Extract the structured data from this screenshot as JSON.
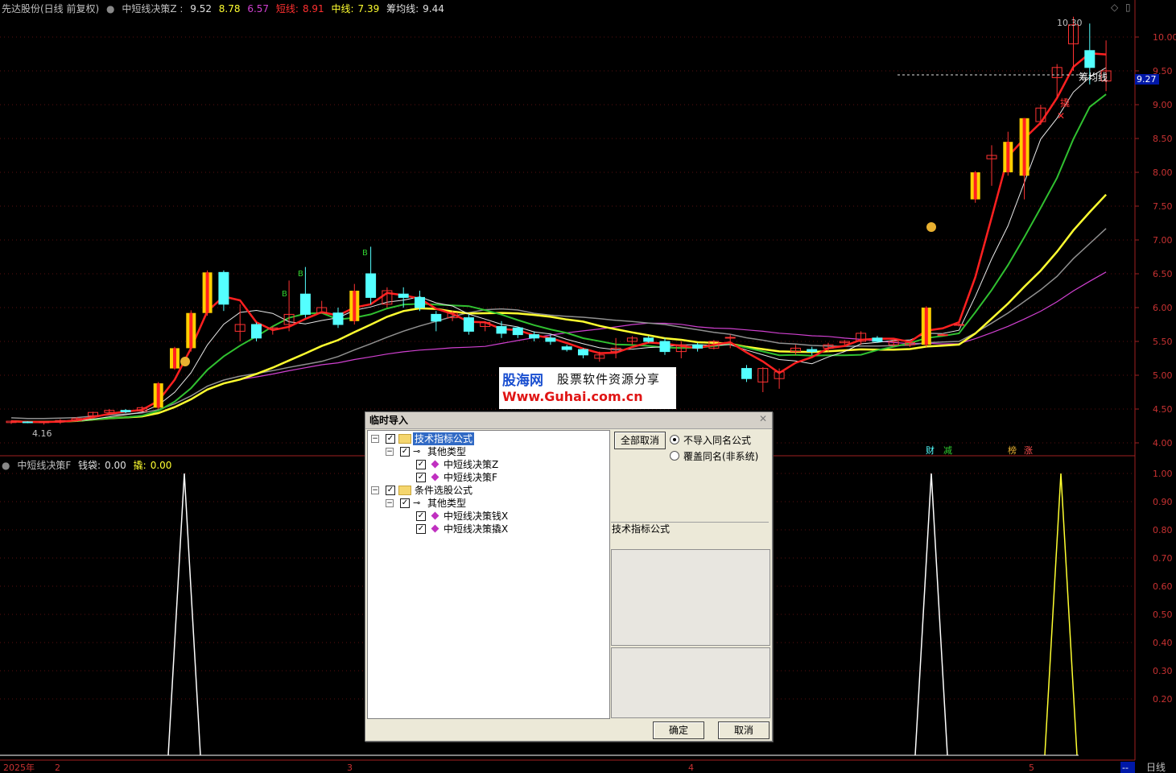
{
  "header": {
    "stock_name": "先达股份(日线 前复权)",
    "indicator_name": "中短线决策Z :",
    "v1": "9.52",
    "v2": "8.78",
    "v3": "6.57",
    "short_label": "短线:",
    "short_value": "8.91",
    "mid_label": "中线:",
    "mid_value": "7.39",
    "chip_label": "筹均线:",
    "chip_value": "9.44"
  },
  "sub_header": {
    "indicator_name": "中短线决策F",
    "money_label": "钱袋:",
    "money_value": "0.00",
    "pry_label": "撬:",
    "pry_value": "0.00"
  },
  "price_axis": [
    "10.00",
    "9.50",
    "9.00",
    "8.50",
    "8.00",
    "7.50",
    "7.00",
    "6.50",
    "6.00",
    "5.50",
    "5.00",
    "4.50",
    "4.00"
  ],
  "price_tag": "9.27",
  "sub_axis": [
    "1.00",
    "0.90",
    "0.80",
    "0.70",
    "0.60",
    "0.50",
    "0.40",
    "0.30",
    "0.20"
  ],
  "time_axis": {
    "year": "2025年",
    "m2": "2",
    "m3": "3",
    "m4": "4",
    "m5": "5",
    "period": "日线",
    "dash": "--"
  },
  "annotations": {
    "high": "10.30",
    "low": "4.16",
    "chip_line": "筹均线",
    "pry": "撬",
    "buy": "B",
    "sig_cai": "财",
    "sig_jian": "减",
    "sig_bang": "榜",
    "sig_zhang": "涨"
  },
  "colors": {
    "up": "#ff3232",
    "down": "#54ffff",
    "short": "#ff2020",
    "mid": "#ffff30",
    "ma_white": "#e8e8e8",
    "ma_magenta": "#d040d0",
    "ma_gray": "#909090",
    "ribbon": "#30c030"
  },
  "watermark": {
    "logo": "股海网",
    "slogan": "股票软件资源分享",
    "url": "Www.Guhai.com.cn"
  },
  "dialog": {
    "title": "临时导入",
    "tree": {
      "group1": "技术指标公式",
      "group1_sub": "其他类型",
      "item1": "中短线决策Z",
      "item2": "中短线决策F",
      "group2": "条件选股公式",
      "group2_sub": "其他类型",
      "item3": "中短线决策钱X",
      "item4": "中短线决策撬X"
    },
    "cancel_all": "全部取消",
    "radio1": "不导入同名公式",
    "radio2": "覆盖同名(非系统)",
    "info_label": "技术指标公式",
    "ok": "确定",
    "cancel": "取消"
  },
  "chart_data": {
    "type": "candlestick",
    "candles": [
      [
        4.3,
        4.32,
        4.28,
        4.33
      ],
      [
        4.31,
        4.3,
        4.29,
        4.32
      ],
      [
        4.3,
        4.31,
        4.27,
        4.32
      ],
      [
        4.31,
        4.33,
        4.28,
        4.35
      ],
      [
        4.33,
        4.36,
        4.31,
        4.38
      ],
      [
        4.4,
        4.45,
        4.38,
        4.46
      ],
      [
        4.45,
        4.48,
        4.43,
        4.5
      ],
      [
        4.48,
        4.46,
        4.44,
        4.5
      ],
      [
        4.47,
        4.52,
        4.46,
        4.54
      ],
      [
        4.52,
        4.88,
        4.5,
        4.9
      ],
      [
        5.1,
        5.4,
        5.08,
        5.42
      ],
      [
        5.4,
        5.92,
        5.35,
        5.96
      ],
      [
        5.92,
        6.52,
        5.88,
        6.55
      ],
      [
        6.52,
        6.05,
        5.95,
        6.55
      ],
      [
        5.65,
        5.75,
        5.5,
        6.05
      ],
      [
        5.75,
        5.55,
        5.5,
        5.78
      ],
      [
        5.68,
        5.7,
        5.6,
        5.72
      ],
      [
        5.75,
        5.9,
        5.65,
        6.4
      ],
      [
        6.2,
        5.9,
        5.85,
        6.6
      ],
      [
        5.92,
        6.0,
        5.95,
        6.1
      ],
      [
        5.92,
        5.75,
        5.7,
        6.0
      ],
      [
        5.8,
        6.25,
        5.75,
        6.35
      ],
      [
        6.5,
        6.15,
        6.05,
        6.9
      ],
      [
        6.05,
        6.25,
        6.0,
        6.3
      ],
      [
        6.2,
        6.15,
        6.0,
        6.3
      ],
      [
        6.15,
        6.0,
        5.95,
        6.25
      ],
      [
        5.9,
        5.8,
        5.65,
        5.95
      ],
      [
        5.85,
        5.92,
        5.8,
        5.95
      ],
      [
        5.85,
        5.65,
        5.6,
        5.9
      ],
      [
        5.72,
        5.78,
        5.65,
        5.8
      ],
      [
        5.72,
        5.62,
        5.55,
        5.8
      ],
      [
        5.7,
        5.6,
        5.55,
        5.72
      ],
      [
        5.6,
        5.55,
        5.5,
        5.65
      ],
      [
        5.55,
        5.5,
        5.45,
        5.6
      ],
      [
        5.42,
        5.38,
        5.35,
        5.45
      ],
      [
        5.38,
        5.3,
        5.25,
        5.4
      ],
      [
        5.25,
        5.3,
        5.2,
        5.35
      ],
      [
        5.35,
        5.4,
        5.25,
        5.55
      ],
      [
        5.5,
        5.55,
        5.45,
        5.58
      ],
      [
        5.55,
        5.5,
        5.48,
        5.58
      ],
      [
        5.5,
        5.35,
        5.3,
        5.55
      ],
      [
        5.35,
        5.45,
        5.25,
        5.5
      ],
      [
        5.45,
        5.4,
        5.35,
        5.48
      ],
      [
        5.4,
        5.5,
        5.38,
        5.52
      ],
      [
        5.55,
        5.56,
        5.4,
        5.6
      ],
      [
        5.1,
        4.95,
        4.9,
        5.15
      ],
      [
        4.9,
        5.1,
        4.75,
        5.12
      ],
      [
        4.95,
        5.05,
        4.8,
        5.1
      ],
      [
        5.35,
        5.4,
        5.3,
        5.45
      ],
      [
        5.38,
        5.35,
        5.3,
        5.42
      ],
      [
        5.4,
        5.45,
        5.35,
        5.48
      ],
      [
        5.48,
        5.5,
        5.45,
        5.52
      ],
      [
        5.5,
        5.62,
        5.45,
        5.65
      ],
      [
        5.55,
        5.5,
        5.48,
        5.58
      ],
      [
        5.45,
        5.5,
        5.42,
        5.52
      ],
      [
        5.45,
        5.48,
        5.42,
        5.5
      ],
      [
        5.45,
        6.0,
        5.42,
        6.02
      ],
      [
        5.6,
        5.6,
        5.58,
        5.62
      ],
      [
        5.75,
        5.75,
        5.72,
        5.78
      ],
      [
        7.6,
        8.0,
        7.55,
        8.02
      ],
      [
        8.2,
        8.25,
        7.8,
        8.4
      ],
      [
        8.0,
        8.45,
        7.95,
        8.6
      ],
      [
        7.95,
        8.8,
        7.6,
        8.8
      ],
      [
        8.75,
        8.95,
        8.7,
        9.0
      ],
      [
        9.4,
        9.55,
        9.1,
        9.6
      ],
      [
        9.9,
        10.18,
        9.5,
        10.3
      ],
      [
        9.8,
        9.55,
        9.3,
        10.2
      ],
      [
        9.35,
        9.5,
        9.2,
        9.95
      ]
    ],
    "short_line": [
      4.8,
      4.6,
      4.42,
      4.35,
      4.33,
      4.35,
      4.38,
      4.4,
      4.45,
      4.55,
      4.85,
      5.2,
      5.45,
      5.6,
      5.62,
      5.68,
      5.7,
      5.73,
      5.8,
      5.9,
      6.0,
      6.05,
      6.1
    ],
    "mid_line": [
      4.3,
      4.32,
      4.36,
      4.45,
      4.6,
      4.8,
      4.95,
      5.05,
      5.1,
      5.2,
      5.3,
      5.4,
      5.45,
      5.5,
      5.5,
      5.48,
      5.45,
      5.4,
      5.35,
      5.3,
      5.3,
      5.35,
      5.45,
      5.8,
      6.4,
      7.0,
      7.4
    ],
    "sub_peaks": [
      1.0,
      1.0,
      1.0
    ],
    "ylim": [
      3.88,
      10.45
    ]
  }
}
